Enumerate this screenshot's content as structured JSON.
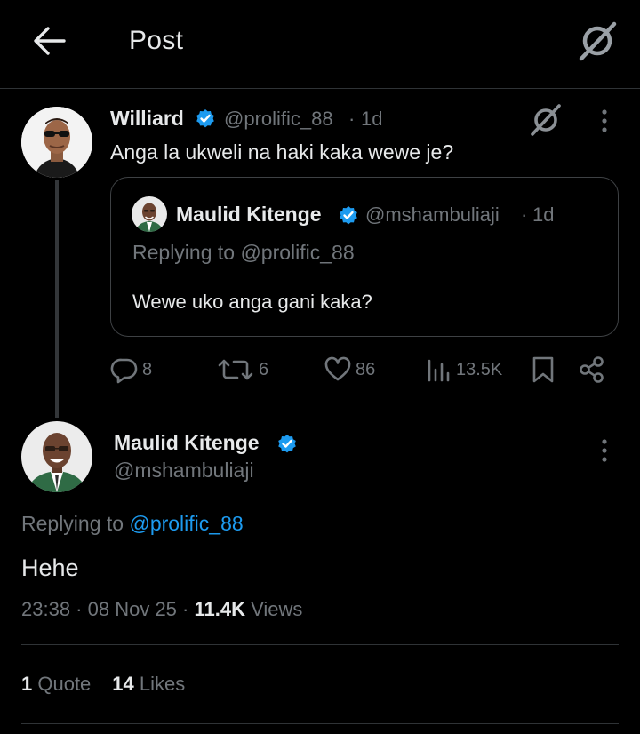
{
  "header": {
    "title": "Post",
    "back_icon": "arrow-left-icon",
    "grok_icon": "grok-icon"
  },
  "parent_tweet": {
    "name": "Williard",
    "handle": "@prolific_88",
    "dot": "·",
    "time": "1d",
    "text": "Anga la ukweli na haki kaka wewe je?",
    "verified": true,
    "quote": {
      "name": "Maulid Kitenge",
      "handle": "@mshambuliaji",
      "dot": "·",
      "time": "1d",
      "replying_to": "Replying to @prolific_88",
      "text": "Wewe uko anga gani kaka?",
      "verified": true
    },
    "actions": {
      "replies": "8",
      "reposts": "6",
      "likes": "86",
      "views": "13.5K"
    }
  },
  "main_tweet": {
    "name": "Maulid Kitenge",
    "handle": "@mshambuliaji",
    "verified": true,
    "replying_prefix": "Replying to ",
    "replying_mention": "@prolific_88",
    "text": "Hehe",
    "time": "23:38",
    "date": "08 Nov 25",
    "sep": " · ",
    "views_count": "11.4K",
    "views_label": " Views",
    "quotes_count": "1",
    "quotes_label": " Quote",
    "likes_count": "14",
    "likes_label": " Likes"
  },
  "colors": {
    "background": "#000000",
    "text": "#e7e9ea",
    "muted": "#71767b",
    "accent": "#1d9bf0",
    "border": "#2f3336"
  }
}
